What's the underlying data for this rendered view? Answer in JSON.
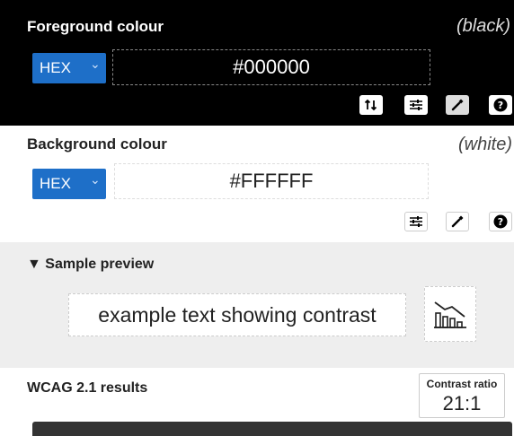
{
  "foreground": {
    "title": "Foreground colour",
    "colour_name": "(black)",
    "format": "HEX",
    "value": "#000000",
    "background_color": "#000000",
    "tools": [
      "swap-icon",
      "sliders-icon",
      "eyedropper-icon",
      "help-icon"
    ]
  },
  "background": {
    "title": "Background colour",
    "colour_name": "(white)",
    "format": "HEX",
    "value": "#FFFFFF",
    "background_color": "#FFFFFF",
    "tools": [
      "sliders-icon",
      "eyedropper-icon",
      "help-icon"
    ]
  },
  "preview": {
    "title": "▼ Sample preview",
    "sample_text": "example text showing contrast",
    "chart_icon": "chart-icon"
  },
  "results": {
    "title": "WCAG 2.1 results",
    "ratio_label": "Contrast ratio",
    "ratio_value": "21:1"
  },
  "colors": {
    "select_blue": "#1E6FC8",
    "preview_bg": "#EEEEEE"
  }
}
